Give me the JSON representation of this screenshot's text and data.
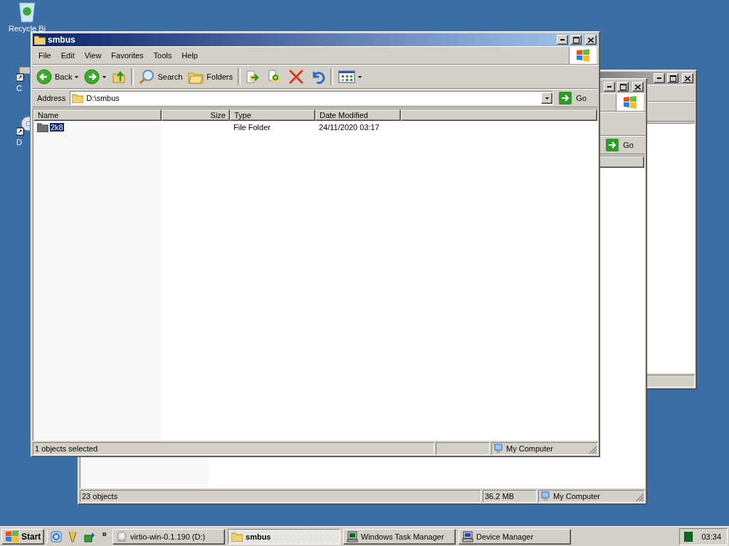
{
  "desktop_icons": [
    {
      "label": "Recycle Bi",
      "kind": "recycle"
    },
    {
      "label": "C",
      "kind": "drive"
    },
    {
      "label": "D",
      "kind": "cd"
    }
  ],
  "back_window": {
    "go": "Go",
    "status": {
      "count": "23 objects",
      "size": "36.2 MB",
      "zone": "My Computer"
    }
  },
  "window": {
    "title": "smbus",
    "menu": [
      "File",
      "Edit",
      "View",
      "Favorites",
      "Tools",
      "Help"
    ],
    "toolbar": {
      "back": "Back",
      "search": "Search",
      "folders": "Folders"
    },
    "address": {
      "label": "Address",
      "value": "D:\\smbus",
      "go": "Go"
    },
    "columns": [
      "Name",
      "Size",
      "Type",
      "Date Modified"
    ],
    "rows": [
      {
        "name": "2k8",
        "type": "File Folder",
        "modified": "24/11/2020 03:17",
        "selected": true
      }
    ],
    "status": {
      "text": "1 objects selected",
      "zone": "My Computer"
    }
  },
  "taskbar": {
    "start": "Start",
    "chevron": "»",
    "tasks": [
      {
        "label": "virtio-win-0.1.190 (D:)",
        "kind": "cd",
        "selected": false
      },
      {
        "label": "smbus",
        "kind": "folder",
        "selected": true
      },
      {
        "label": "Windows Task Manager",
        "kind": "monitor",
        "selected": false
      },
      {
        "label": "Device Manager",
        "kind": "computer",
        "selected": false
      }
    ],
    "clock": "03:34"
  }
}
